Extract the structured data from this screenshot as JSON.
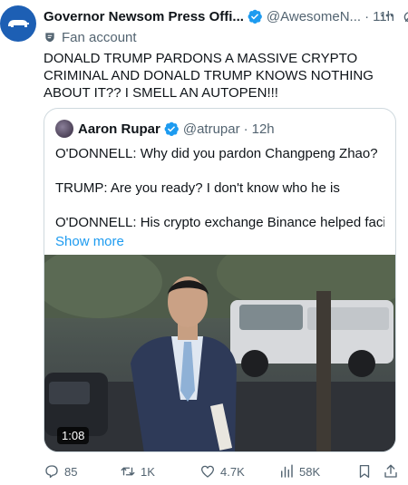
{
  "author": {
    "display_name": "Governor Newsom Press Offi...",
    "handle": "@AwesomeN...",
    "time": "11h",
    "separator": "·",
    "fan_label": "Fan account"
  },
  "tweet": {
    "text": "DONALD TRUMP PARDONS A MASSIVE CRYPTO CRIMINAL AND DONALD TRUMP KNOWS NOTHING ABOUT IT?? I SMELL AN AUTOPEN!!!"
  },
  "quote": {
    "display_name": "Aaron Rupar",
    "handle": "@atrupar",
    "separator": "·",
    "time": "12h",
    "paragraphs": [
      "O'DONNELL: Why did you pardon Changpeng Zhao?",
      "TRUMP: Are you ready? I don't know who he is",
      "O'DONNELL: His crypto exchange Binance helped facilitat..."
    ],
    "show_more": "Show more",
    "video_duration": "1:08"
  },
  "actions": {
    "replies": "85",
    "reposts": "1K",
    "likes": "4.7K",
    "views": "58K"
  },
  "colors": {
    "accent": "#1d9bf0",
    "muted": "#536471",
    "text": "#0f1419",
    "avatar_bg": "#1d5fb4",
    "verified": "#1d9bf0"
  },
  "icons": [
    "verified-badge-icon",
    "grok-icon",
    "more-icon",
    "fan-account-icon",
    "reply-icon",
    "repost-icon",
    "like-icon",
    "views-icon",
    "bookmark-icon",
    "share-icon"
  ]
}
